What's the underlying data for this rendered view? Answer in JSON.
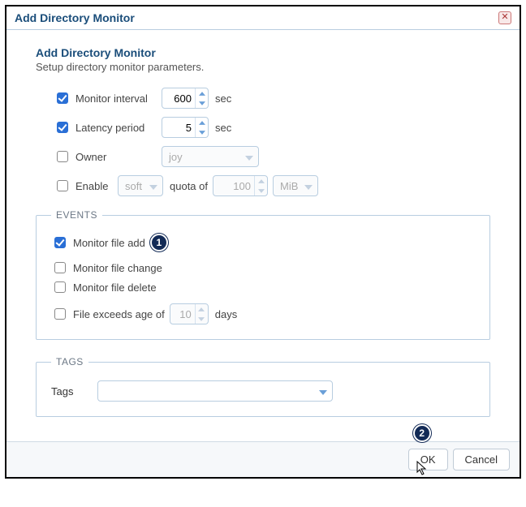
{
  "window": {
    "title": "Add Directory Monitor"
  },
  "header": {
    "title": "Add Directory Monitor",
    "subtitle": "Setup directory monitor parameters."
  },
  "params": {
    "monitor_interval": {
      "label": "Monitor interval",
      "value": "600",
      "unit": "sec",
      "checked": true
    },
    "latency_period": {
      "label": "Latency period",
      "value": "5",
      "unit": "sec",
      "checked": true
    },
    "owner": {
      "label": "Owner",
      "value": "joy",
      "checked": false
    },
    "enable": {
      "label": "Enable",
      "mode": "soft",
      "mid": "quota of",
      "amount": "100",
      "unit": "MiB",
      "checked": false
    }
  },
  "events": {
    "legend": "EVENTS",
    "file_add": {
      "label": "Monitor file add",
      "checked": true
    },
    "file_change": {
      "label": "Monitor file change",
      "checked": false
    },
    "file_delete": {
      "label": "Monitor file delete",
      "checked": false
    },
    "file_age": {
      "label": "File exceeds age of",
      "value": "10",
      "unit": "days",
      "checked": false
    }
  },
  "tags": {
    "legend": "TAGS",
    "label": "Tags",
    "value": ""
  },
  "buttons": {
    "ok": "OK",
    "cancel": "Cancel"
  },
  "annotations": {
    "badge1": "1",
    "badge2": "2"
  }
}
